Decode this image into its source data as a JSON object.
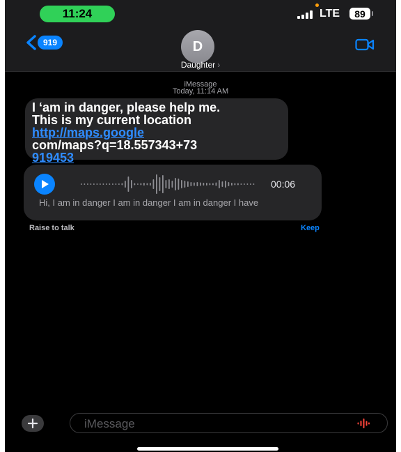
{
  "status_bar": {
    "time": "11:24",
    "network": "LTE",
    "battery": "89"
  },
  "nav": {
    "back_badge": "919",
    "avatar_initial": "D",
    "contact_name": "Daughter",
    "contact_chevron": "›"
  },
  "thread": {
    "service": "iMessage",
    "timestamp": "Today, 11:14 AM",
    "message": {
      "line1": "I ‘am in danger, please help me.",
      "line2": "This is my current location",
      "link_part1": "http://maps.google",
      "line4": "com/maps?q=18.557343+73",
      "link_part2": "919453"
    },
    "audio": {
      "duration": "00:06",
      "transcript": "Hi, I am in danger I am in danger I am in danger I have"
    },
    "raise_to_talk": "Raise to talk",
    "keep": "Keep"
  },
  "input": {
    "placeholder": "iMessage"
  },
  "icons": {
    "back": "chevron-left-icon",
    "video": "video-camera-icon",
    "play": "play-icon",
    "plus": "plus-icon",
    "mic": "waveform-mic-icon"
  },
  "colors": {
    "accent": "#0a84ff",
    "time_pill": "#30d158",
    "bubble": "#262628",
    "mic": "#ff453a"
  }
}
